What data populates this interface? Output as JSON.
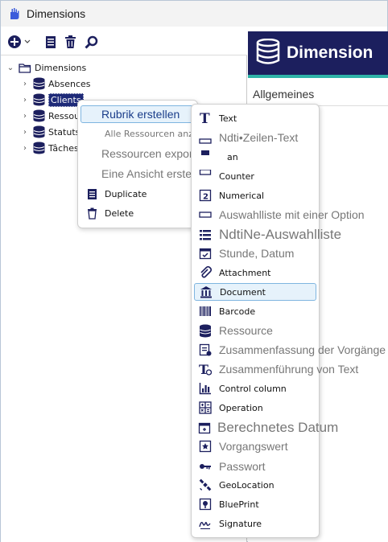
{
  "window": {
    "title": "Dimensions"
  },
  "toolbar": {
    "add_icon": "plus-circle-icon",
    "dropdown_icon": "chevron-down-icon",
    "list_icon": "list-document-icon",
    "delete_icon": "trash-icon",
    "search_icon": "magnifier-icon"
  },
  "tree": {
    "root": "Dimensions",
    "items": [
      {
        "label": "Absences",
        "selected": false
      },
      {
        "label": "Clients",
        "selected": true
      },
      {
        "label": "Ressou",
        "selected": false
      },
      {
        "label": "Statuts",
        "selected": false
      },
      {
        "label": "Tâches",
        "selected": false
      }
    ]
  },
  "context_menu": {
    "create_heading": "Rubrik erstellen",
    "show_all": "Alle Ressourcen anzeigen",
    "export": "Ressourcen exportieren >",
    "create_view": "Eine Ansicht erstellen",
    "duplicate": "Duplicate",
    "delete": "Delete"
  },
  "submenu": {
    "items": [
      {
        "label": "Text",
        "icon": "text-t-icon",
        "style": "norm"
      },
      {
        "label": "Ndti•Zeilen-Text",
        "icon": "multiline-text-icon",
        "style": "big"
      },
      {
        "label": "an",
        "icon": "boolean-icon",
        "style": "norm"
      },
      {
        "label": "Counter",
        "icon": "counter-icon",
        "style": "norm"
      },
      {
        "label": "Numerical",
        "icon": "numeric-2-icon",
        "style": "norm"
      },
      {
        "label": "Auswahlliste mit einer Option",
        "icon": "single-select-icon",
        "style": "big"
      },
      {
        "label": "NdtiNe-Auswahlliste",
        "icon": "multi-select-icon",
        "style": "xl"
      },
      {
        "label": "Stunde, Datum",
        "icon": "calendar-check-icon",
        "style": "big"
      },
      {
        "label": "Attachment",
        "icon": "paperclip-icon",
        "style": "norm"
      },
      {
        "label": "Document",
        "icon": "building-icon",
        "style": "norm",
        "highlighted": true
      },
      {
        "label": "Barcode",
        "icon": "barcode-icon",
        "style": "norm"
      },
      {
        "label": "Ressource",
        "icon": "database-icon",
        "style": "big"
      },
      {
        "label": "Zusammenfassung der Vorgänge",
        "icon": "summary-icon",
        "style": "big"
      },
      {
        "label": "Zusammenführung von Text",
        "icon": "text-merge-icon",
        "style": "big"
      },
      {
        "label": "Control column",
        "icon": "bar-chart-icon",
        "style": "norm"
      },
      {
        "label": "Operation",
        "icon": "calculator-icon",
        "style": "norm"
      },
      {
        "label": "Berechnetes Datum",
        "icon": "calendar-calc-icon",
        "style": "xl"
      },
      {
        "label": "Vorgangswert",
        "icon": "star-box-icon",
        "style": "big"
      },
      {
        "label": "Passwort",
        "icon": "key-icon",
        "style": "big"
      },
      {
        "label": "GeoLocation",
        "icon": "satellite-icon",
        "style": "norm"
      },
      {
        "label": "BluePrint",
        "icon": "map-pin-icon",
        "style": "norm"
      },
      {
        "label": "Signature",
        "icon": "signature-icon",
        "style": "norm"
      }
    ]
  },
  "right_panel": {
    "banner_title": "Dimension",
    "section_title": "Allgemeines"
  },
  "colors": {
    "banner_bg": "#1c1f5e",
    "banner_accent": "#2fb3a8",
    "selection": "#1e2a78",
    "highlight_bg": "#e6f2fb",
    "highlight_border": "#7fb5e0"
  }
}
